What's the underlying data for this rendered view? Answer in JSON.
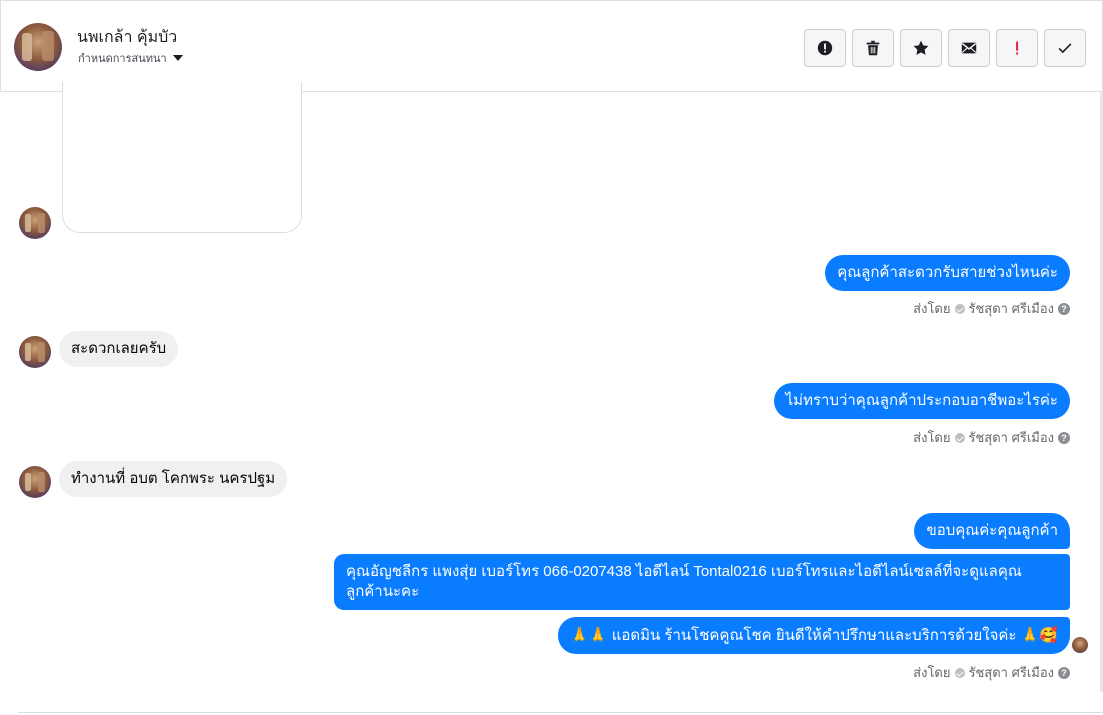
{
  "header": {
    "contact_name": "นพเกล้า คุ้มบัว",
    "assign_label": "กำหนดการสนทนา",
    "actions": [
      {
        "name": "report-icon",
        "title": "!"
      },
      {
        "name": "trash-icon",
        "title": ""
      },
      {
        "name": "star-icon",
        "title": ""
      },
      {
        "name": "envelope-icon",
        "title": ""
      },
      {
        "name": "spam-icon",
        "title": "!"
      },
      {
        "name": "checkmark-icon",
        "title": ""
      }
    ]
  },
  "colors": {
    "outgoing_bubble": "#0a7cff",
    "incoming_bubble": "#f0f0f0",
    "spam_red": "#e41e3f"
  },
  "messages": {
    "out_1": "คุณลูกค้าสะดวกรับสายช่วงไหนค่ะ",
    "in_1": "สะดวกเลยครับ",
    "out_2": "ไม่ทราบว่าคุณลูกค้าประกอบอาชีพอะไรค่ะ",
    "in_2": "ทำงานที่ อบต โคกพระ นครปฐม",
    "out_3": "ขอบคุณค่ะคุณลูกค้า",
    "out_4": "คุณอัญชลีกร แพงสุ่ย      เบอร์โทร 066-0207438 ไอดีไลน์ Tontal0216   เบอร์โทรและไอดีไลน์เซลล์ที่จะดูแลคุณลูกค้านะคะ",
    "out_5_prefix": "🙏🙏",
    "out_5": "แอดมิน ร้านโชคคูณโชค ยินดีให้คำปรึกษาและบริการด้วยใจค่ะ",
    "out_5_suffix": "🙏🥰"
  },
  "sent_by": {
    "prefix": "ส่งโดย",
    "sender": "รัชสุดา ศรีเมือง",
    "help": "?"
  }
}
